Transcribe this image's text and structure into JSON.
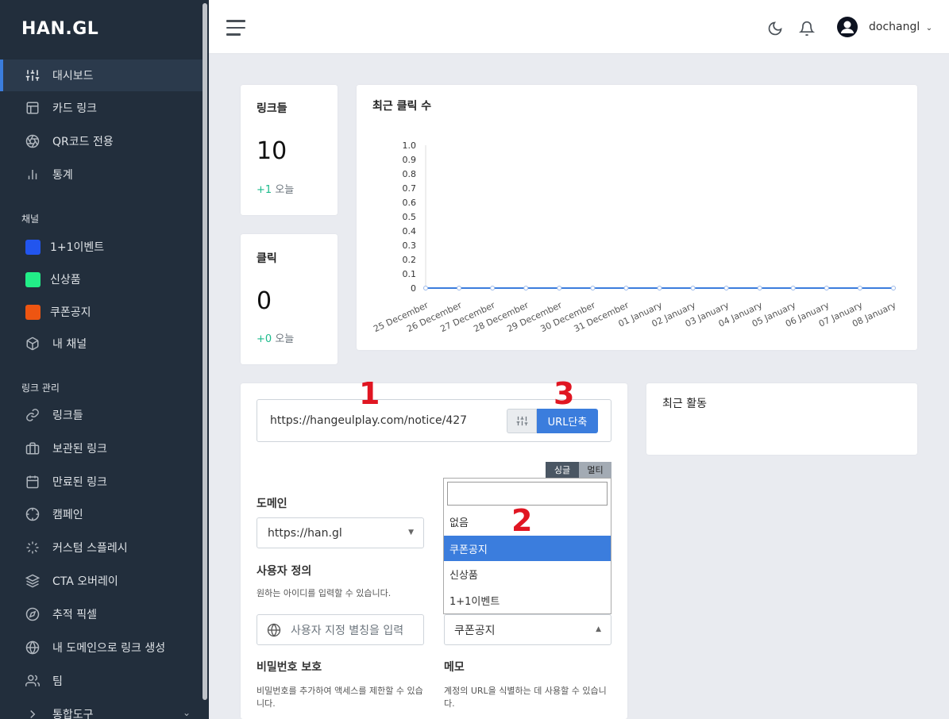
{
  "app": {
    "logo": "HAN.GL"
  },
  "sidebar": {
    "main_items": [
      {
        "label": "대시보드",
        "icon": "sliders-icon"
      },
      {
        "label": "카드 링크",
        "icon": "layout-icon"
      },
      {
        "label": "QR코드 전용",
        "icon": "aperture-icon"
      },
      {
        "label": "통계",
        "icon": "bar-chart-icon"
      }
    ],
    "channels_heading": "채널",
    "channels": [
      {
        "label": "1+1이벤트",
        "color": "#2255ee"
      },
      {
        "label": "신상품",
        "color": "#22ee88"
      },
      {
        "label": "쿠폰공지",
        "color": "#ee5511"
      }
    ],
    "my_channel": "내 채널",
    "links_heading": "링크 관리",
    "link_items": [
      {
        "label": "링크들",
        "icon": "link-icon"
      },
      {
        "label": "보관된 링크",
        "icon": "briefcase-icon"
      },
      {
        "label": "만료된 링크",
        "icon": "calendar-icon"
      },
      {
        "label": "캠페인",
        "icon": "crosshair-icon"
      },
      {
        "label": "커스텀 스플레시",
        "icon": "loader-icon"
      },
      {
        "label": "CTA 오버레이",
        "icon": "layers-icon"
      },
      {
        "label": "추적 픽셀",
        "icon": "compass-icon"
      },
      {
        "label": "내 도메인으로 링크 생성",
        "icon": "globe-icon"
      },
      {
        "label": "팀",
        "icon": "users-icon"
      },
      {
        "label": "통합도구",
        "icon": "chevron-right-icon"
      }
    ]
  },
  "topbar": {
    "username": "dochangl"
  },
  "stats": {
    "links": {
      "title": "링크들",
      "value": "10",
      "delta": "+1",
      "delta_suffix": "오늘"
    },
    "clicks": {
      "title": "클릭",
      "value": "0",
      "delta": "+0",
      "delta_suffix": "오늘"
    }
  },
  "chart_title": "최근 클릭 수",
  "chart_data": {
    "type": "line",
    "categories": [
      "25 December",
      "26 December",
      "27 December",
      "28 December",
      "29 December",
      "30 December",
      "31 December",
      "01 January",
      "02 January",
      "03 January",
      "04 January",
      "05 January",
      "06 January",
      "07 January",
      "08 January"
    ],
    "series": [
      {
        "values": [
          0,
          0,
          0,
          0,
          0,
          0,
          0,
          0,
          0,
          0,
          0,
          0,
          0,
          0,
          0
        ],
        "color": "#3b7ddd"
      }
    ],
    "ylim": [
      0,
      1.0
    ],
    "yticks": [
      "1.0",
      "0.9",
      "0.8",
      "0.7",
      "0.6",
      "0.5",
      "0.4",
      "0.3",
      "0.2",
      "0.1",
      "0"
    ],
    "grid": false
  },
  "shorten": {
    "url_value": "https://hangeulplay.com/notice/427",
    "button": "URL단축",
    "mode_single": "싱글",
    "mode_multi": "멀티",
    "domain_label": "도메인",
    "domain_value": "https://han.gl",
    "custom_label": "사용자 정의",
    "custom_hint": "원하는 아이디를 입력할 수 있습니다.",
    "custom_placeholder": "사용자 지정 별칭을 입력",
    "channel_value": "쿠폰공지",
    "channel_options": [
      "없음",
      "쿠폰공지",
      "신상품",
      "1+1이벤트"
    ],
    "channel_selected": "쿠폰공지",
    "password_label": "비밀번호 보호",
    "password_hint": "비밀번호를 추가하여 액세스를 제한할 수 있습니다.",
    "memo_label": "메모",
    "memo_hint": "계정의 URL을 식별하는 데 사용할 수 있습니다."
  },
  "markers": {
    "m1": "1",
    "m2": "2",
    "m3": "3"
  },
  "activity": {
    "title": "최근 활동"
  }
}
